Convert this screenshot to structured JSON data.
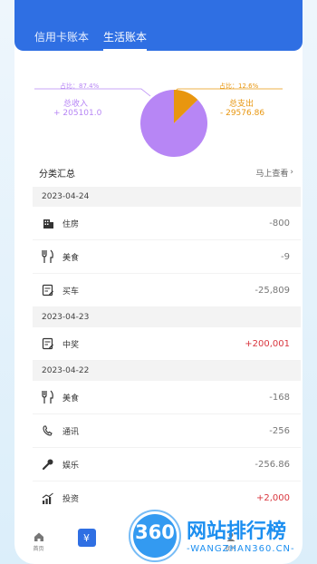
{
  "tabs": [
    {
      "label": "信用卡账本",
      "active": false
    },
    {
      "label": "生活账本",
      "active": true
    }
  ],
  "pie": {
    "income": {
      "ratio": "占比：87.4%",
      "label": "总收入",
      "value": "+ 205101.0",
      "color": "#b786f5"
    },
    "expense": {
      "ratio": "占比：12.6%",
      "label": "总支出",
      "value": "- 29576.86",
      "color": "#e8960f"
    }
  },
  "chart_data": {
    "type": "pie",
    "categories": [
      "总收入",
      "总支出"
    ],
    "values": [
      87.4,
      12.6
    ]
  },
  "summary": {
    "title": "分类汇总",
    "more": "马上查看"
  },
  "groups": [
    {
      "date": "2023-04-24",
      "items": [
        {
          "icon": "building-icon",
          "name": "住房",
          "amount": "-800",
          "positive": false
        },
        {
          "icon": "food-icon",
          "name": "美食",
          "amount": "-9",
          "positive": false
        },
        {
          "icon": "note-icon",
          "name": "买车",
          "amount": "-25,809",
          "positive": false
        }
      ]
    },
    {
      "date": "2023-04-23",
      "items": [
        {
          "icon": "note-icon",
          "name": "中奖",
          "amount": "+200,001",
          "positive": true
        }
      ]
    },
    {
      "date": "2023-04-22",
      "items": [
        {
          "icon": "food-icon",
          "name": "美食",
          "amount": "-168",
          "positive": false
        },
        {
          "icon": "phone-icon",
          "name": "通讯",
          "amount": "-256",
          "positive": false
        },
        {
          "icon": "mic-icon",
          "name": "娱乐",
          "amount": "-256.86",
          "positive": false
        },
        {
          "icon": "chart-icon",
          "name": "投资",
          "amount": "+2,000",
          "positive": true
        }
      ]
    }
  ],
  "tabbar": [
    {
      "label": "首页",
      "icon": "home-icon"
    },
    {
      "label": "",
      "icon": "yuan-icon"
    },
    {
      "label": "",
      "icon": "blank"
    },
    {
      "label": "",
      "icon": "blank"
    },
    {
      "label": "我的",
      "icon": "user-icon"
    }
  ],
  "watermark": {
    "brand": "360",
    "title": "网站排行榜",
    "url": "-WANGZHAN360.CN-"
  }
}
